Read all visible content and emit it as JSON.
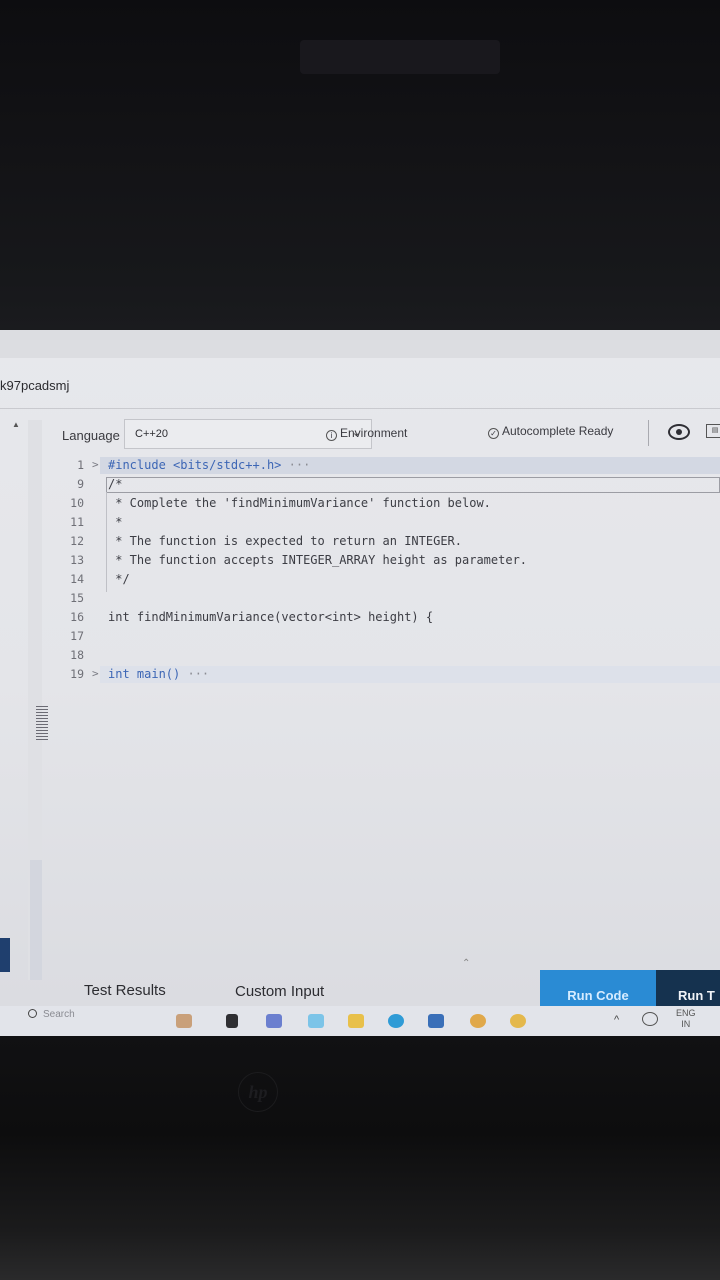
{
  "tab_title": "k97pcadsmj",
  "toolbar": {
    "language_label": "Language",
    "language_value": "C++20",
    "environment": "Environment",
    "autocomplete": "Autocomplete Ready",
    "environment_icon": "info-icon",
    "autocomplete_icon": "check-circle-icon"
  },
  "editor": {
    "lines": [
      {
        "num": "1",
        "text": "#include <bits/stdc++.h>",
        "folded": true
      },
      {
        "num": "9",
        "text": "/*"
      },
      {
        "num": "10",
        "text": " * Complete the 'findMinimumVariance' function below."
      },
      {
        "num": "11",
        "text": " *"
      },
      {
        "num": "12",
        "text": " * The function is expected to return an INTEGER."
      },
      {
        "num": "13",
        "text": " * The function accepts INTEGER_ARRAY height as parameter."
      },
      {
        "num": "14",
        "text": " */"
      },
      {
        "num": "15",
        "text": ""
      },
      {
        "num": "16",
        "text": "int findMinimumVariance(vector<int> height) {"
      },
      {
        "num": "17",
        "text": ""
      },
      {
        "num": "18",
        "text": ""
      },
      {
        "num": "19",
        "text": "int main()",
        "folded": true
      }
    ]
  },
  "bottom": {
    "test_results": "Test Results",
    "custom_input": "Custom Input",
    "run_code": "Run Code",
    "run_tests": "Run T"
  },
  "taskbar": {
    "search": "Search",
    "lang": "ENG",
    "region": "IN"
  },
  "colors": {
    "run_code": "#2a8bd4",
    "run_tests": "#15324f",
    "keyword": "#3c66b5"
  }
}
